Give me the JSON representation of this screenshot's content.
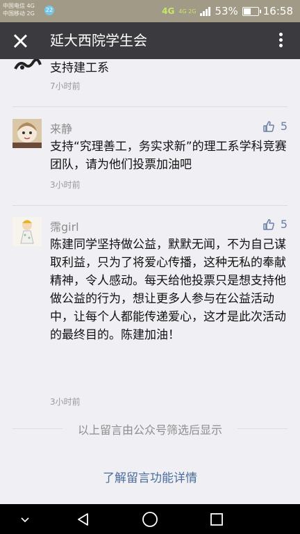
{
  "status_bar": {
    "carrier1": "中国电信 4G",
    "carrier2": "中国移动 2G",
    "badge": "22",
    "net_main": "4G",
    "net_sub": "4G 2G",
    "battery": "53%",
    "time": "16:58",
    "battery_level": 0.53
  },
  "header": {
    "title": "延大西院学生会"
  },
  "comments": [
    {
      "name": "",
      "text": "支持建工系",
      "time": "7小时前"
    },
    {
      "name": "来静",
      "likes": "5",
      "text": "支持“究理善工，务实求新”的理工系学科竞赛团队，请为他们投票加油吧",
      "time": "3小时前"
    },
    {
      "name": "霈girl",
      "likes": "5",
      "text": "陈建同学坚持做公益，默默无闻，不为自己谋取利益，只为了将爱心传播，这种无私的奉献精神，令人感动。每天给他投票只是想支持他做公益的行为，想让更多人参与在公益活动中，让每个人都能传递爱心，这才是此次活动的最终目的。陈建加油！",
      "time": "3小时前"
    }
  ],
  "footer": {
    "note": "以上留言由公众号筛选后显示",
    "link": "了解留言功能详情"
  },
  "colors": {
    "header_bg": "#3a3a3f",
    "link": "#4a6d9c",
    "like": "#6a7fa5"
  }
}
